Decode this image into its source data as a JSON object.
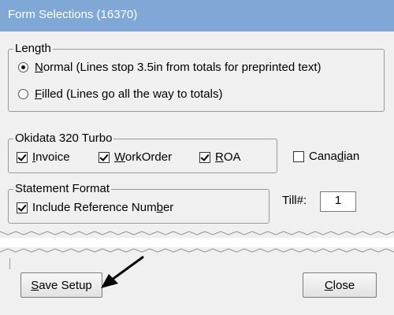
{
  "window": {
    "title": "Form Selections (16370)"
  },
  "length": {
    "legend": "Length",
    "normal": {
      "accel": "N",
      "rest": "ormal (Lines stop 3.5in from totals for preprinted text)",
      "checked": true
    },
    "filled": {
      "accel": "F",
      "rest": "illed (Lines go all the way to totals)",
      "checked": false
    }
  },
  "printer": {
    "legend": "Okidata 320 Turbo",
    "invoice": {
      "accel": "I",
      "rest": "nvoice",
      "checked": true
    },
    "workorder": {
      "accel": "W",
      "rest": "orkOrder",
      "checked": true
    },
    "roa": {
      "accel": "R",
      "rest": "OA",
      "checked": true
    }
  },
  "canadian": {
    "pre": "Cana",
    "accel": "d",
    "post": "ian",
    "checked": false
  },
  "statement": {
    "legend": "Statement Format",
    "include_ref": {
      "pre": "Include Reference Num",
      "accel": "b",
      "post": "er",
      "checked": true
    }
  },
  "till": {
    "label": "Till#:",
    "value": "1"
  },
  "buttons": {
    "save": {
      "accel": "S",
      "rest": "ave Setup"
    },
    "close": {
      "accel": "C",
      "rest": "lose"
    }
  },
  "icons": {
    "radio": "radio-button",
    "checkbox": "checkbox",
    "arrow": "callout-arrow"
  },
  "colors": {
    "titlebar": "#7fa8d6",
    "client": "#f0f0f0"
  }
}
